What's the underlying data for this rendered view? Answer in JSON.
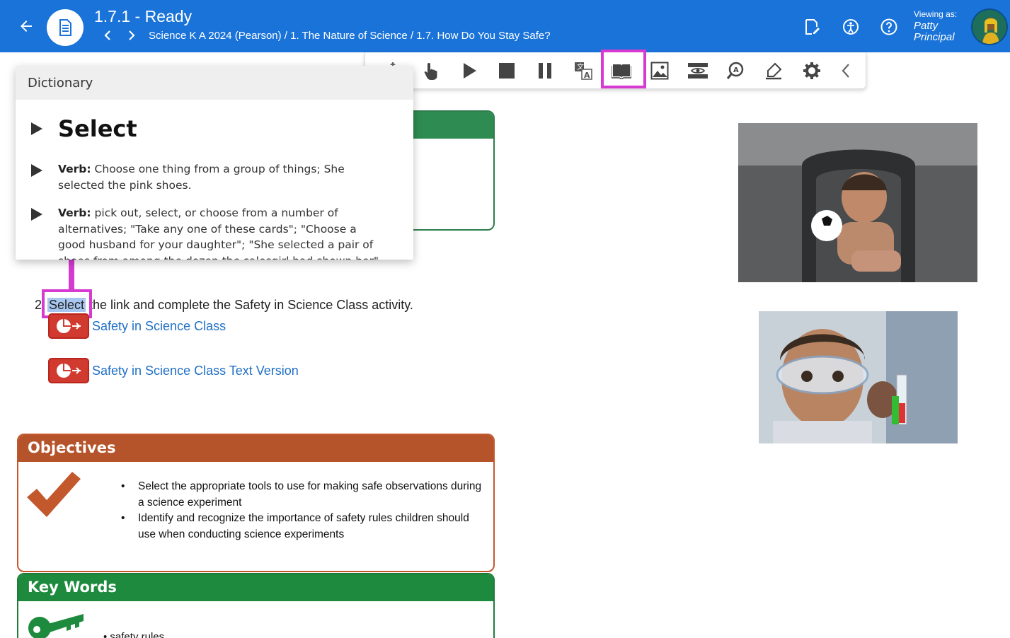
{
  "header": {
    "title": "1.7.1 - Ready",
    "breadcrumb": "Science K A 2024 (Pearson) / 1. The Nature of Science / 1.7. How Do You Stay Safe?",
    "viewing_label": "Viewing as:",
    "viewing_name": "Patty Principal",
    "bg_color": "#1a73d8"
  },
  "toolbar": {
    "buttons": [
      "move-icon",
      "pointer-icon",
      "play-icon",
      "stop-icon",
      "pause-icon",
      "translate-icon",
      "dictionary-icon",
      "picture-dictionary-icon",
      "screen-mask-icon",
      "text-finder-icon",
      "highlighter-icon",
      "settings-icon",
      "collapse-icon"
    ],
    "active": "dictionary-icon",
    "highlight_color": "#d63ad0"
  },
  "dictionary": {
    "heading": "Dictionary",
    "word": "Select",
    "definitions": [
      {
        "pos": "Verb:",
        "text": "Choose one thing from a group of things; She selected the pink shoes."
      },
      {
        "pos": "Verb:",
        "text": "pick out, select, or choose from a number of alternatives; \"Take any one of these cards\"; \"Choose a good husband for your daughter\"; \"She selected a pair of shoes from among the dozen the salesgirl had shown her\""
      }
    ]
  },
  "content": {
    "step_number": "2",
    "step_word": "Select",
    "step_rest": " the link and complete the Safety in Science Class activity.",
    "links": [
      "Safety in Science Class",
      "Safety in Science Class Text Version"
    ],
    "objectives": {
      "title": "Objectives",
      "items": [
        "Select the appropriate tools to use for making safe observations during a science experiment",
        "Identify and recognize the importance of safety rules children should use when conducting science experiments"
      ]
    },
    "keywords": {
      "title": "Key Words",
      "items": [
        "safety rules"
      ]
    }
  }
}
